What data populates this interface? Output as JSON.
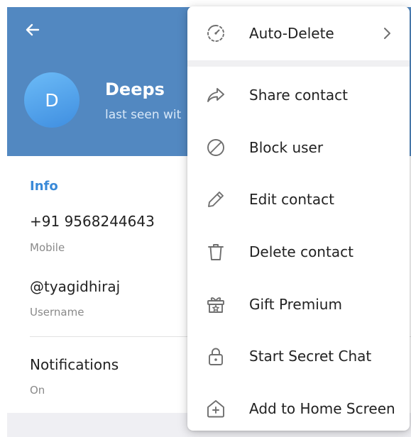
{
  "profile": {
    "avatar_initial": "D",
    "name": "Deeps",
    "status": "last seen wit"
  },
  "info": {
    "title": "Info",
    "phone": {
      "value": "+91 9568244643",
      "label": "Mobile"
    },
    "username": {
      "value": "@tyagidhiraj",
      "label": "Username"
    },
    "notifications": {
      "value": "Notifications",
      "label": "On"
    }
  },
  "menu": {
    "items": [
      {
        "label": "Auto-Delete",
        "icon": "timer-icon",
        "has_submenu": true
      },
      {
        "label": "Share contact",
        "icon": "share-icon"
      },
      {
        "label": "Block user",
        "icon": "block-icon"
      },
      {
        "label": "Edit contact",
        "icon": "pencil-icon"
      },
      {
        "label": "Delete contact",
        "icon": "trash-icon"
      },
      {
        "label": "Gift Premium",
        "icon": "gift-icon"
      },
      {
        "label": "Start Secret Chat",
        "icon": "lock-icon"
      },
      {
        "label": "Add to Home Screen",
        "icon": "add-home-icon"
      }
    ]
  },
  "colors": {
    "header": "#5288c1",
    "accent": "#3a8ad8"
  }
}
